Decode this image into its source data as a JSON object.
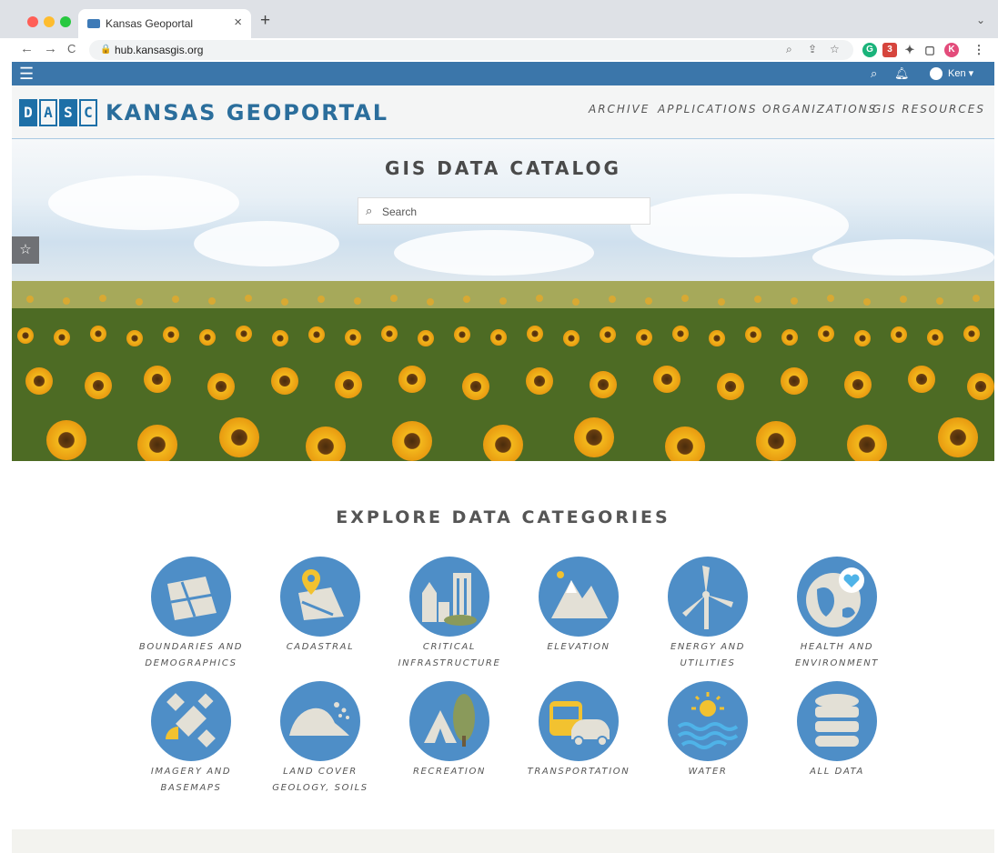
{
  "browser": {
    "tab_title": "Kansas Geoportal",
    "tab_close": "×",
    "new_tab": "+",
    "tabs_menu": "⌄",
    "url": "hub.kansasgis.org",
    "back": "←",
    "forward": "→",
    "reload": "C",
    "profile_initial": "K",
    "ext_badge": "3"
  },
  "topbar": {
    "user_name": "Ken ▾"
  },
  "header": {
    "logo_letters": [
      "D",
      "A",
      "S",
      "C"
    ],
    "brand": "KANSAS GEOPORTAL",
    "nav": [
      "ARCHIVE",
      "APPLICATIONS",
      "ORGANIZATIONS",
      "GIS RESOURCES"
    ]
  },
  "hero": {
    "title": "GIS DATA CATALOG",
    "search_placeholder": "Search"
  },
  "categories": {
    "heading": "EXPLORE DATA CATEGORIES",
    "items": [
      {
        "line1": "BOUNDARIES AND",
        "line2": "DEMOGRAPHICS",
        "icon": "boundaries-icon"
      },
      {
        "line1": "CADASTRAL",
        "line2": "",
        "icon": "cadastral-icon"
      },
      {
        "line1": "CRITICAL",
        "line2": "INFRASTRUCTURE",
        "icon": "critical-infrastructure-icon"
      },
      {
        "line1": "ELEVATION",
        "line2": "",
        "icon": "elevation-icon"
      },
      {
        "line1": "ENERGY AND",
        "line2": "UTILITIES",
        "icon": "energy-icon"
      },
      {
        "line1": "HEALTH AND",
        "line2": "ENVIRONMENT",
        "icon": "health-icon"
      },
      {
        "line1": "IMAGERY AND",
        "line2": "BASEMAPS",
        "icon": "imagery-icon"
      },
      {
        "line1": "LAND COVER",
        "line2": "GEOLOGY, SOILS",
        "icon": "land-cover-icon"
      },
      {
        "line1": "RECREATION",
        "line2": "",
        "icon": "recreation-icon"
      },
      {
        "line1": "TRANSPORTATION",
        "line2": "",
        "icon": "transportation-icon"
      },
      {
        "line1": "WATER",
        "line2": "",
        "icon": "water-icon"
      },
      {
        "line1": "ALL DATA",
        "line2": "",
        "icon": "all-data-icon"
      }
    ]
  },
  "colors": {
    "accent": "#3b76aa",
    "category_circle": "#4e8ec7",
    "brand_text": "#2b6e9c"
  }
}
